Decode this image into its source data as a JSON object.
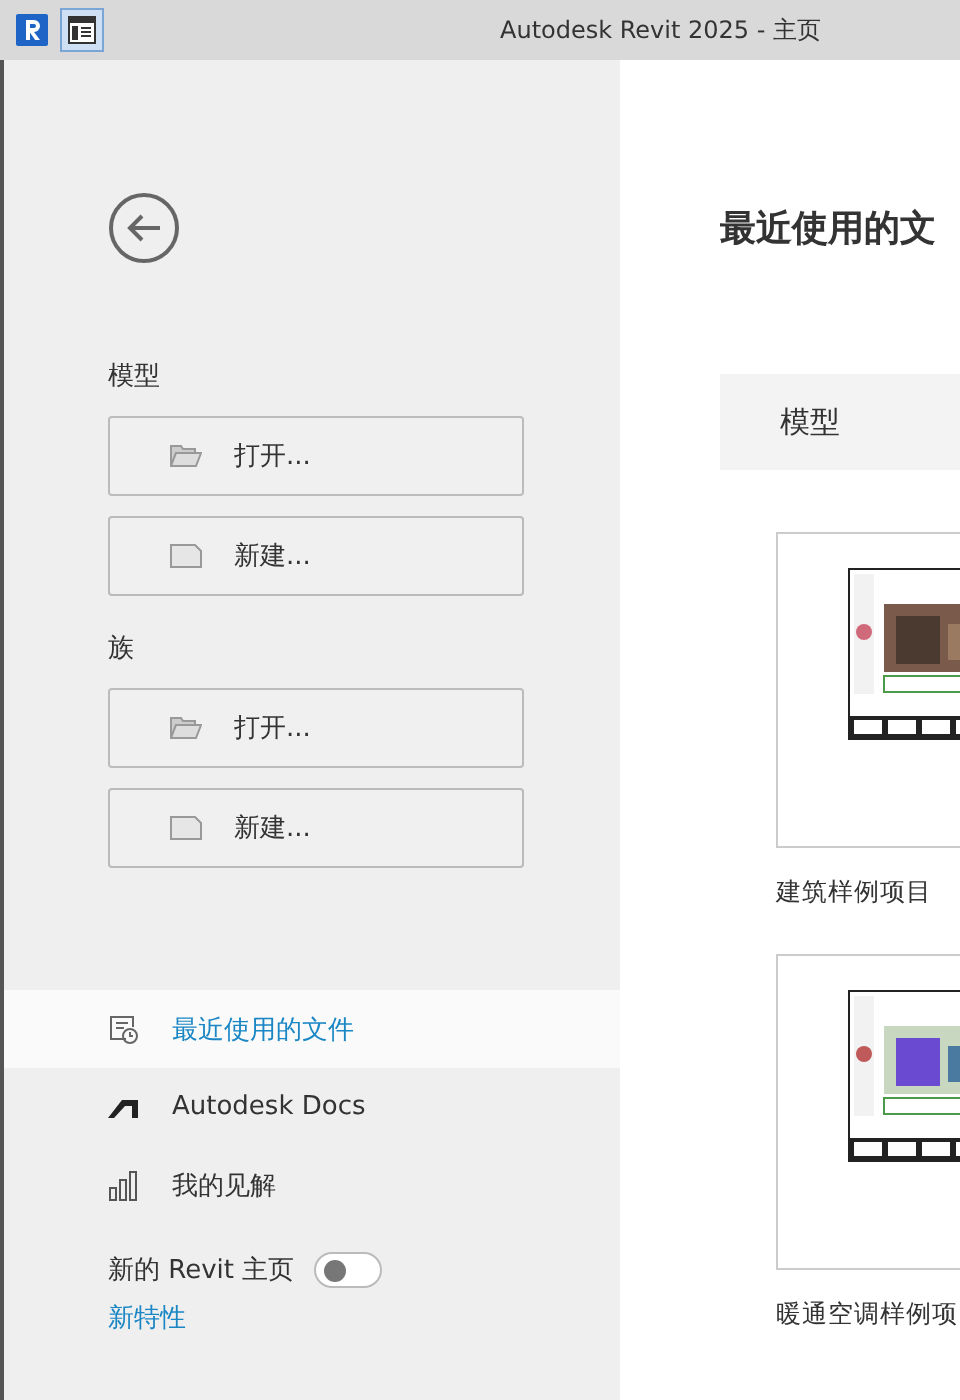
{
  "window": {
    "title": "Autodesk Revit 2025 - 主页"
  },
  "sidebar": {
    "sections": [
      {
        "label": "模型",
        "buttons": [
          {
            "kind": "open",
            "label": "打开..."
          },
          {
            "kind": "new",
            "label": "新建..."
          }
        ]
      },
      {
        "label": "族",
        "buttons": [
          {
            "kind": "open",
            "label": "打开..."
          },
          {
            "kind": "new",
            "label": "新建..."
          }
        ]
      }
    ],
    "nav": [
      {
        "kind": "recent",
        "label": "最近使用的文件",
        "selected": true
      },
      {
        "kind": "docs",
        "label": "Autodesk Docs",
        "selected": false
      },
      {
        "kind": "insights",
        "label": "我的见解",
        "selected": false
      }
    ],
    "toggle": {
      "label": "新的 Revit 主页",
      "on": false
    },
    "link": "新特性"
  },
  "main": {
    "heading": "最近使用的文",
    "tab": "模型",
    "cards": [
      {
        "label": "建筑样例项目",
        "kind": "picture"
      },
      {
        "label": "暖通空调样例项",
        "kind": "picture"
      }
    ]
  }
}
